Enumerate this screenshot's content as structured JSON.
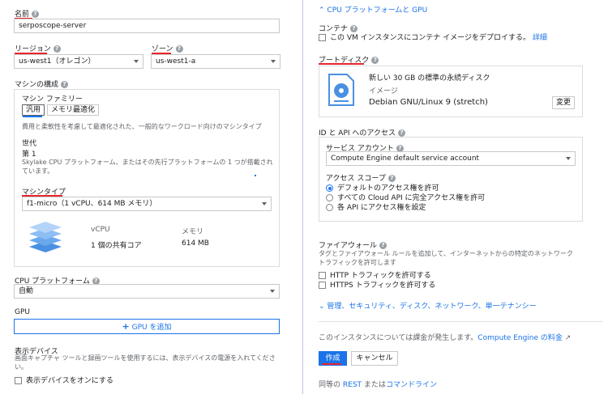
{
  "left": {
    "name_label": "名前",
    "name_value": "serposcope-server",
    "region_label": "リージョン",
    "region_value": "us-west1（オレゴン）",
    "zone_label": "ゾーン",
    "zone_value": "us-west1-a",
    "machine_config_label": "マシンの構成",
    "machine_family_label": "マシン ファミリー",
    "tab_general": "汎用",
    "tab_memory": "メモリ最適化",
    "family_desc": "費用と柔軟性を考慮して最適化された、一般的なワークロード向けのマシンタイプ",
    "generation_label": "世代",
    "generation_value": "第 1",
    "generation_desc": "Skylake CPU プラットフォーム、またはその先行プラットフォームの 1 つが搭載されています。",
    "machine_type_label": "マシンタイプ",
    "machine_type_value": "f1-micro（1 vCPU、614 MB メモリ）",
    "vcpu_header": "vCPU",
    "vcpu_value": "1 個の共有コア",
    "memory_header": "メモリ",
    "memory_value": "614 MB",
    "cpu_platform_label": "CPU プラットフォーム",
    "cpu_platform_value": "自動",
    "gpu_label": "GPU",
    "gpu_button": "GPU を追加",
    "display_label": "表示デバイス",
    "display_desc": "画面キャプチャ ツールと録画ツールを使用するには、表示デバイスの電源を入れてください。",
    "display_checkbox": "表示デバイスをオンにする"
  },
  "right": {
    "cpu_gpu_link": "CPU プラットフォームと GPU",
    "container_label": "コンテナ",
    "container_checkbox": "この VM インスタンスにコンテナ イメージをデプロイする。",
    "container_link": "詳細",
    "boot_disk_label": "ブートディスク",
    "boot_disk_title": "新しい 30 GB の標準の永続ディスク",
    "boot_image_label": "イメージ",
    "boot_image_value": "Debian GNU/Linux 9 (stretch)",
    "change_button": "変更",
    "id_api_label": "ID と API へのアクセス",
    "service_account_label": "サービス アカウント",
    "service_account_value": "Compute Engine default service account",
    "access_scope_label": "アクセス スコープ",
    "scope_options": [
      "デフォルトのアクセス権を許可",
      "すべての Cloud API に完全アクセス権を許可",
      "各 API にアクセス権を設定"
    ],
    "firewall_label": "ファイアウォール",
    "firewall_desc_1": "タグとファイアウォール ルールを追加して、インターネットからの特定のネットワーク",
    "firewall_desc_2": "トラフィックを許可します",
    "http_label": "HTTP トラフィックを許可する",
    "https_label": "HTTPS トラフィックを許可する",
    "more_link": "管理、セキュリティ、ディスク、ネットワーク、単一テナンシー",
    "billing_text": "このインスタンスについては課金が発生します。",
    "billing_link": "Compute Engine の料金",
    "create_button": "作成",
    "cancel_button": "キャンセル",
    "rest_prefix": "同等の",
    "rest_link": "REST",
    "rest_mid": "または",
    "cli_link": "コマンドライン"
  },
  "colors": {
    "accent": "#1a73e8",
    "annotation_underline": "#e8262c"
  }
}
